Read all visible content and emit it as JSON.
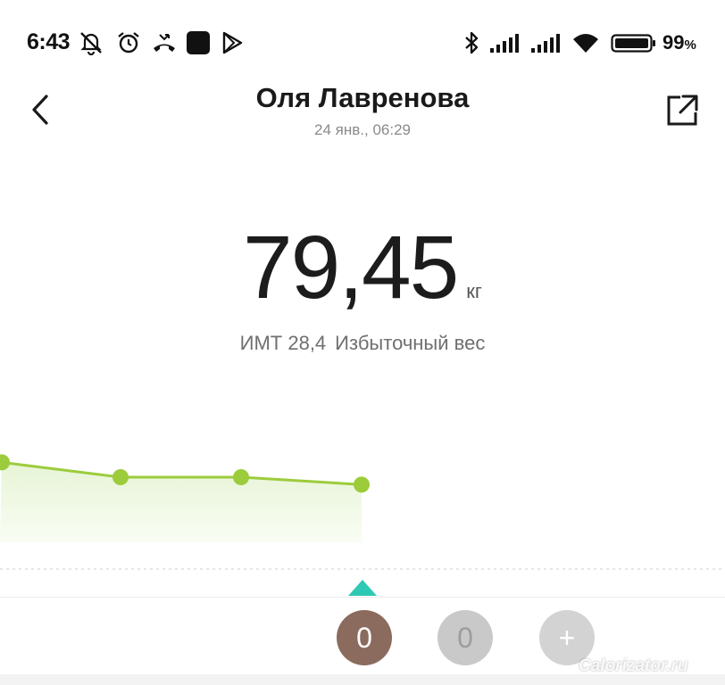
{
  "status_bar": {
    "time": "6:43",
    "battery_percent": "99",
    "battery_suffix": "%",
    "icons": [
      "notifications-off-icon",
      "alarm-icon",
      "missed-call-icon",
      "app-icon",
      "play-icon",
      "bluetooth-icon",
      "signal-icon",
      "signal-icon",
      "wifi-icon",
      "battery-icon"
    ]
  },
  "header": {
    "title": "Оля Лавренова",
    "subtitle": "24 янв., 06:29",
    "back_icon": "chevron-left-icon",
    "share_icon": "share-icon"
  },
  "measurement": {
    "weight": "79,45",
    "unit": "кг",
    "bmi_label": "ИМТ 28,4",
    "status": "Избыточный вес"
  },
  "chart_data": {
    "type": "line",
    "values": [
      79.6,
      79.5,
      79.5,
      79.45
    ],
    "color": "#9ccc3c",
    "fill": "#eef8e2",
    "grid": false
  },
  "users": [
    {
      "label": "0",
      "color": "#8a6b5e",
      "selected": true
    },
    {
      "label": "0",
      "color": "#c9c9c9",
      "selected": false
    },
    {
      "label": "+",
      "color": "#d3d3d3",
      "selected": false
    }
  ],
  "accent": "#2ec9b3",
  "watermark": "Calorizator.ru"
}
